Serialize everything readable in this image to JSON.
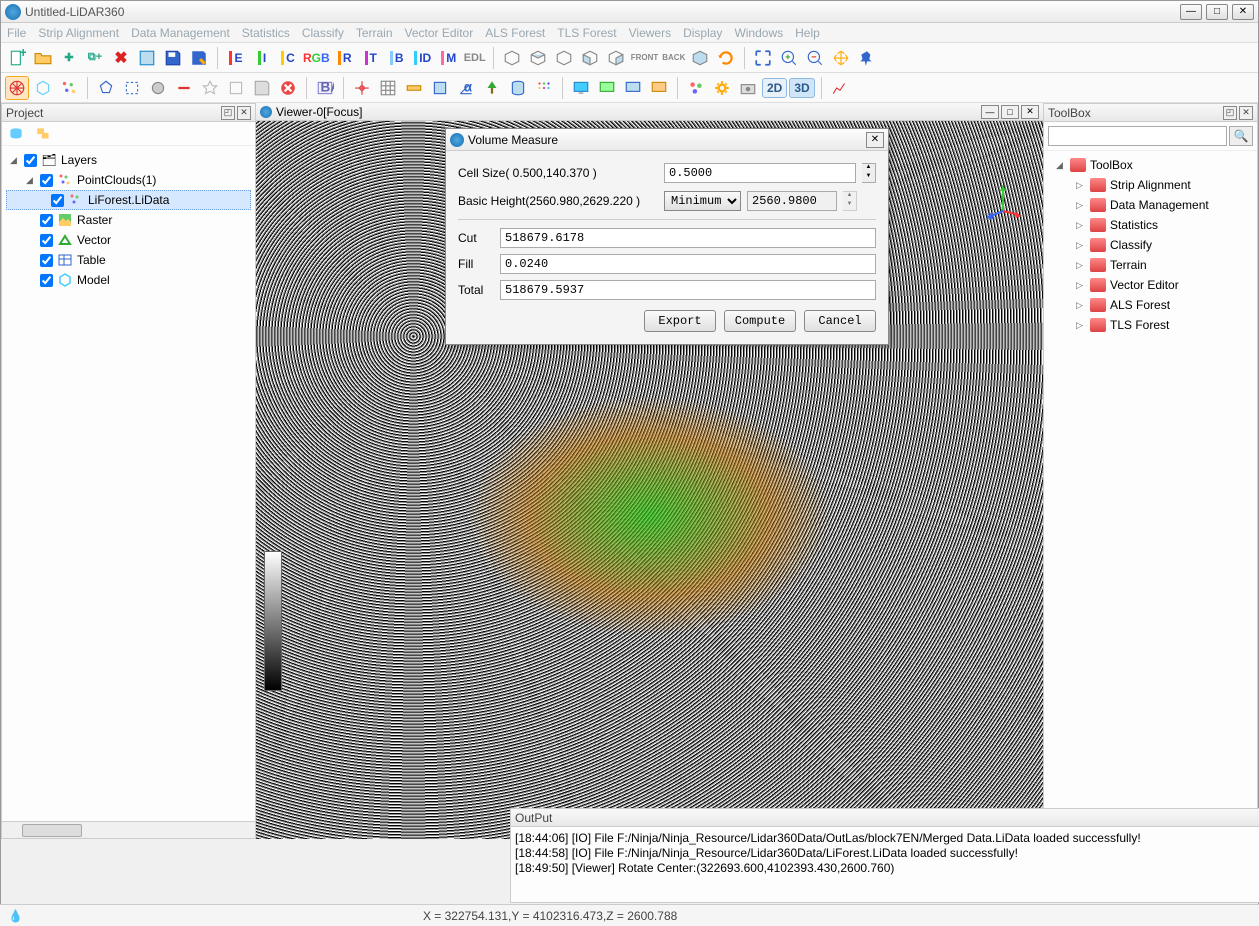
{
  "window": {
    "title": "Untitled-LiDAR360"
  },
  "menu": [
    "File",
    "Strip Alignment",
    "Data Management",
    "Statistics",
    "Classify",
    "Terrain",
    "Vector Editor",
    "ALS Forest",
    "TLS Forest",
    "Viewers",
    "Display",
    "Windows",
    "Help"
  ],
  "toolbar1_labels": {
    "e": "E",
    "i": "I",
    "c": "C",
    "rgb": "R G B",
    "r": "R",
    "t": "T",
    "b": "B",
    "id": "ID",
    "m": "M",
    "edl": "EDL",
    "front": "FRONT",
    "back": "BACK"
  },
  "toolbar2": {
    "twod": "2D",
    "threed": "3D"
  },
  "project": {
    "title": "Project",
    "root": "Layers",
    "items": [
      {
        "label": "PointClouds(1)",
        "children": [
          {
            "label": "LiForest.LiData"
          }
        ]
      },
      {
        "label": "Raster"
      },
      {
        "label": "Vector"
      },
      {
        "label": "Table"
      },
      {
        "label": "Model"
      }
    ]
  },
  "viewer": {
    "title": "Viewer-0[Focus]"
  },
  "dialog": {
    "title": "Volume Measure",
    "cell_label": "Cell Size( 0.500,140.370 )",
    "cell_value": "0.5000",
    "basic_label": "Basic Height(2560.980,2629.220 )",
    "basic_mode": "Minimum",
    "basic_value": "2560.9800",
    "cut_label": "Cut",
    "cut_value": "518679.6178",
    "fill_label": "Fill",
    "fill_value": "0.0240",
    "total_label": "Total",
    "total_value": "518679.5937",
    "export": "Export",
    "compute": "Compute",
    "cancel": "Cancel"
  },
  "toolbox": {
    "title": "ToolBox",
    "root": "ToolBox",
    "items": [
      "Strip Alignment",
      "Data Management",
      "Statistics",
      "Classify",
      "Terrain",
      "Vector Editor",
      "ALS Forest",
      "TLS Forest"
    ],
    "search_placeholder": ""
  },
  "output": {
    "title": "OutPut",
    "lines": [
      "[18:44:06] [IO]      File F:/Ninja/Ninja_Resource/Lidar360Data/OutLas/block7EN/Merged Data.LiData loaded successfully!",
      "[18:44:58] [IO]      File F:/Ninja/Ninja_Resource/Lidar360Data/LiForest.LiData loaded successfully!",
      "[18:49:50] [Viewer]     Rotate Center:(322693.600,4102393.430,2600.760)"
    ]
  },
  "status": {
    "coords": "X = 322754.131,Y = 4102316.473,Z = 2600.788"
  }
}
